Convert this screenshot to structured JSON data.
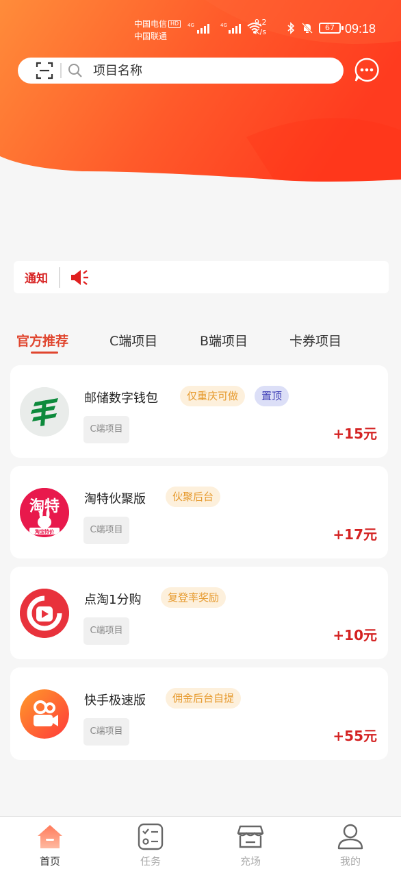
{
  "status_bar": {
    "carrier1": "中国电信",
    "hd": "HD",
    "carrier2": "中国联通",
    "net_speed": "9.2",
    "net_unit": "K/s",
    "battery": "67",
    "time": "09:18"
  },
  "search": {
    "placeholder": "项目名称"
  },
  "notice": {
    "label": "通知"
  },
  "tabs": [
    {
      "label": "官方推荐",
      "active": true
    },
    {
      "label": "C端项目"
    },
    {
      "label": "B端项目"
    },
    {
      "label": "卡券项目"
    }
  ],
  "projects": [
    {
      "title": "邮储数字钱包",
      "tags": [
        "仅重庆可做",
        "置顶"
      ],
      "type": "C端项目",
      "reward": "+15元",
      "logo": "postal-savings-logo"
    },
    {
      "title": "淘特伙聚版",
      "tags": [
        "伙聚后台"
      ],
      "type": "C端项目",
      "reward": "+17元",
      "logo": "taote-logo",
      "logo_text": "淘特",
      "logo_sub": "淘宝特价"
    },
    {
      "title": "点淘1分购",
      "tags": [
        "复登率奖励"
      ],
      "type": "C端项目",
      "reward": "+10元",
      "logo": "diantao-logo"
    },
    {
      "title": "快手极速版",
      "tags": [
        "佣金后台自提"
      ],
      "type": "C端项目",
      "reward": "+55元",
      "logo": "kuaishou-logo"
    }
  ],
  "bottom_nav": [
    {
      "label": "首页",
      "active": true,
      "icon": "home-icon"
    },
    {
      "label": "任务",
      "icon": "task-icon"
    },
    {
      "label": "充场",
      "icon": "store-icon"
    },
    {
      "label": "我的",
      "icon": "profile-icon"
    }
  ],
  "colors": {
    "accent": "#e0452e",
    "reward": "#d42222",
    "hero_start": "#ff8c3a",
    "hero_end": "#ff3b1f"
  }
}
